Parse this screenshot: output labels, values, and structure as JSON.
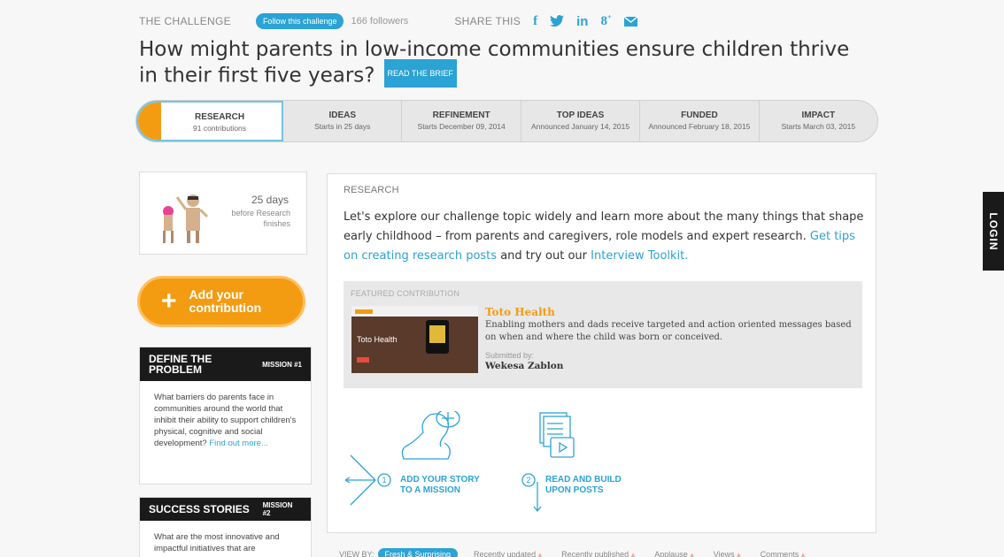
{
  "header": {
    "challenge_label": "THE CHALLENGE",
    "follow_label": "Follow this challenge",
    "followers": "166 followers",
    "share_label": "SHARE THIS",
    "social": [
      "facebook-icon",
      "twitter-icon",
      "linkedin-icon",
      "googleplus-icon",
      "email-icon"
    ]
  },
  "title": "How might parents in low-income communities ensure children thrive in their first five years?",
  "brief_label": "READ THE BRIEF",
  "phases": [
    {
      "title": "RESEARCH",
      "sub": "91 contributions"
    },
    {
      "title": "IDEAS",
      "sub": "Starts in 25 days"
    },
    {
      "title": "REFINEMENT",
      "sub": "Starts December 09, 2014"
    },
    {
      "title": "TOP IDEAS",
      "sub": "Announced January 14, 2015"
    },
    {
      "title": "FUNDED",
      "sub": "Announced February 18, 2015"
    },
    {
      "title": "IMPACT",
      "sub": "Starts March 03, 2015"
    }
  ],
  "timer": {
    "days": "25 days",
    "sub": "before Research finishes"
  },
  "add_button": {
    "line1": "Add your",
    "line2": "contribution"
  },
  "missions": [
    {
      "title": "DEFINE THE PROBLEM",
      "num": "MISSION #1",
      "body": "What barriers do parents face in communities around the world that inhibit their ability to support children's physical, cognitive and social development?",
      "link": "Find out more..."
    },
    {
      "title": "SUCCESS STORIES",
      "num": "MISSION #2",
      "body": "What are the most innovative and impactful initiatives that are"
    }
  ],
  "main": {
    "heading": "RESEARCH",
    "intro": "Let's explore our challenge topic widely and learn more about the many things that shape early childhood – from parents and caregivers, role models and expert research.",
    "link1": "Get tips on creating research posts",
    "mid": "and try out our",
    "link2": "Interview Toolkit."
  },
  "featured": {
    "label": "FEATURED CONTRIBUTION",
    "thumb_label": "Toto Health",
    "title": "Toto Health",
    "desc": "Enabling mothers and dads receive targeted and action oriented messages based on when and where the child was born or conceived.",
    "submitted_label": "Submitted by:",
    "author": "Wekesa Zablon"
  },
  "steps": [
    {
      "num": "1",
      "line1": "ADD YOUR STORY",
      "line2": "TO A MISSION"
    },
    {
      "num": "2",
      "line1": "READ AND BUILD",
      "line2": "UPON POSTS"
    }
  ],
  "viewby": {
    "label": "VIEW BY:",
    "active": "Fresh & Surprising",
    "options": [
      "Recently updated",
      "Recently published",
      "Applause",
      "Views",
      "Comments"
    ]
  },
  "login_label": "LOGIN",
  "colors": {
    "accent": "#2ba3d4",
    "orange": "#f39c12"
  }
}
